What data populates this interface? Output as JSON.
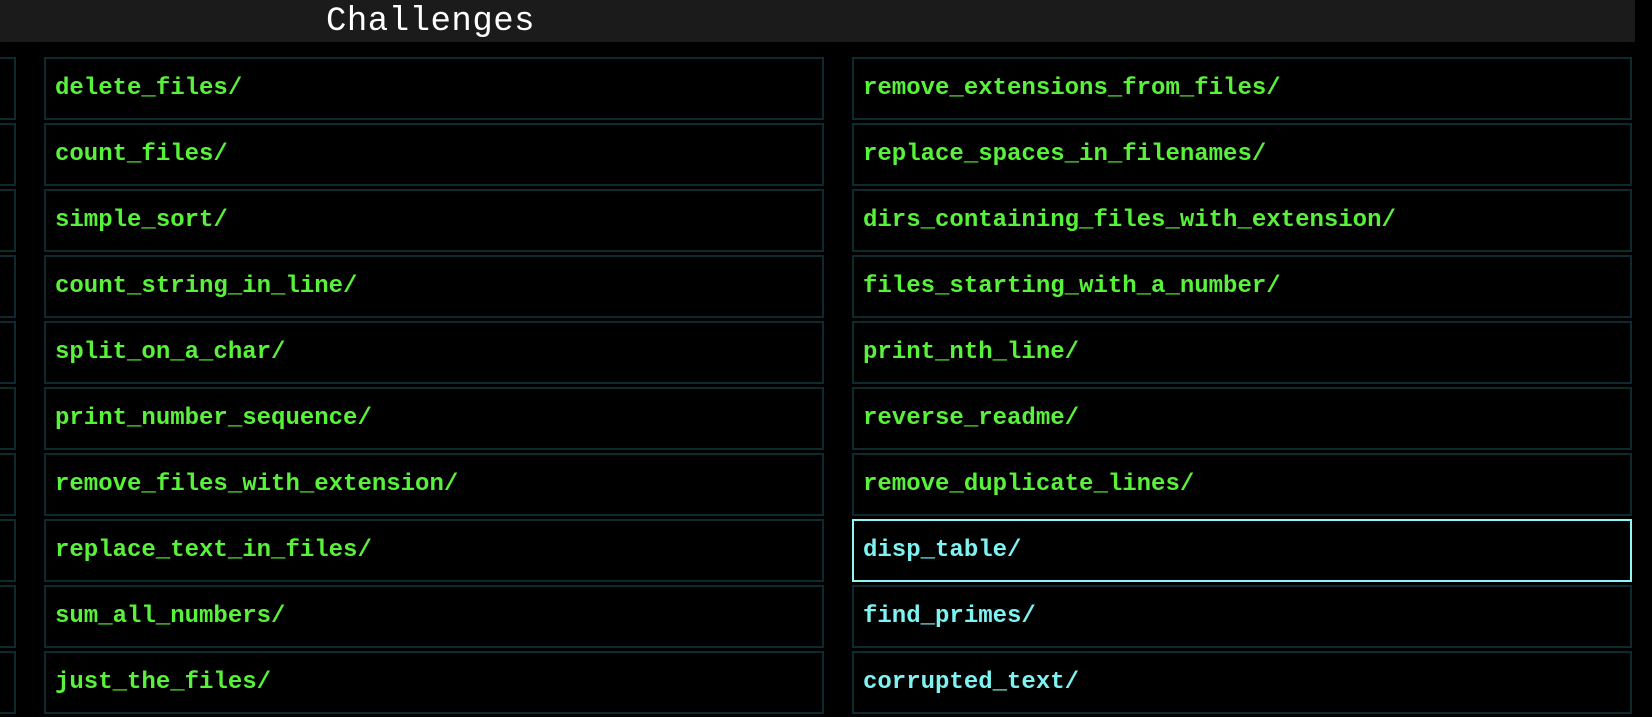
{
  "header": {
    "title": "Challenges"
  },
  "colors": {
    "green_text": "#59f23a",
    "cyan_text": "#7ff2f2",
    "cell_border": "#0f2a2e",
    "selected_border": "#8ff7f7",
    "header_bg": "#1b1b1b"
  },
  "left_column": [
    "delete_files/",
    "count_files/",
    "simple_sort/",
    "count_string_in_line/",
    "split_on_a_char/",
    "print_number_sequence/",
    "remove_files_with_extension/",
    "replace_text_in_files/",
    "sum_all_numbers/",
    "just_the_files/"
  ],
  "right_column": [
    "remove_extensions_from_files/",
    "replace_spaces_in_filenames/",
    "dirs_containing_files_with_extension/",
    "files_starting_with_a_number/",
    "print_nth_line/",
    "reverse_readme/",
    "remove_duplicate_lines/",
    "disp_table/",
    "find_primes/",
    "corrupted_text/"
  ],
  "selected_item": "disp_table/"
}
